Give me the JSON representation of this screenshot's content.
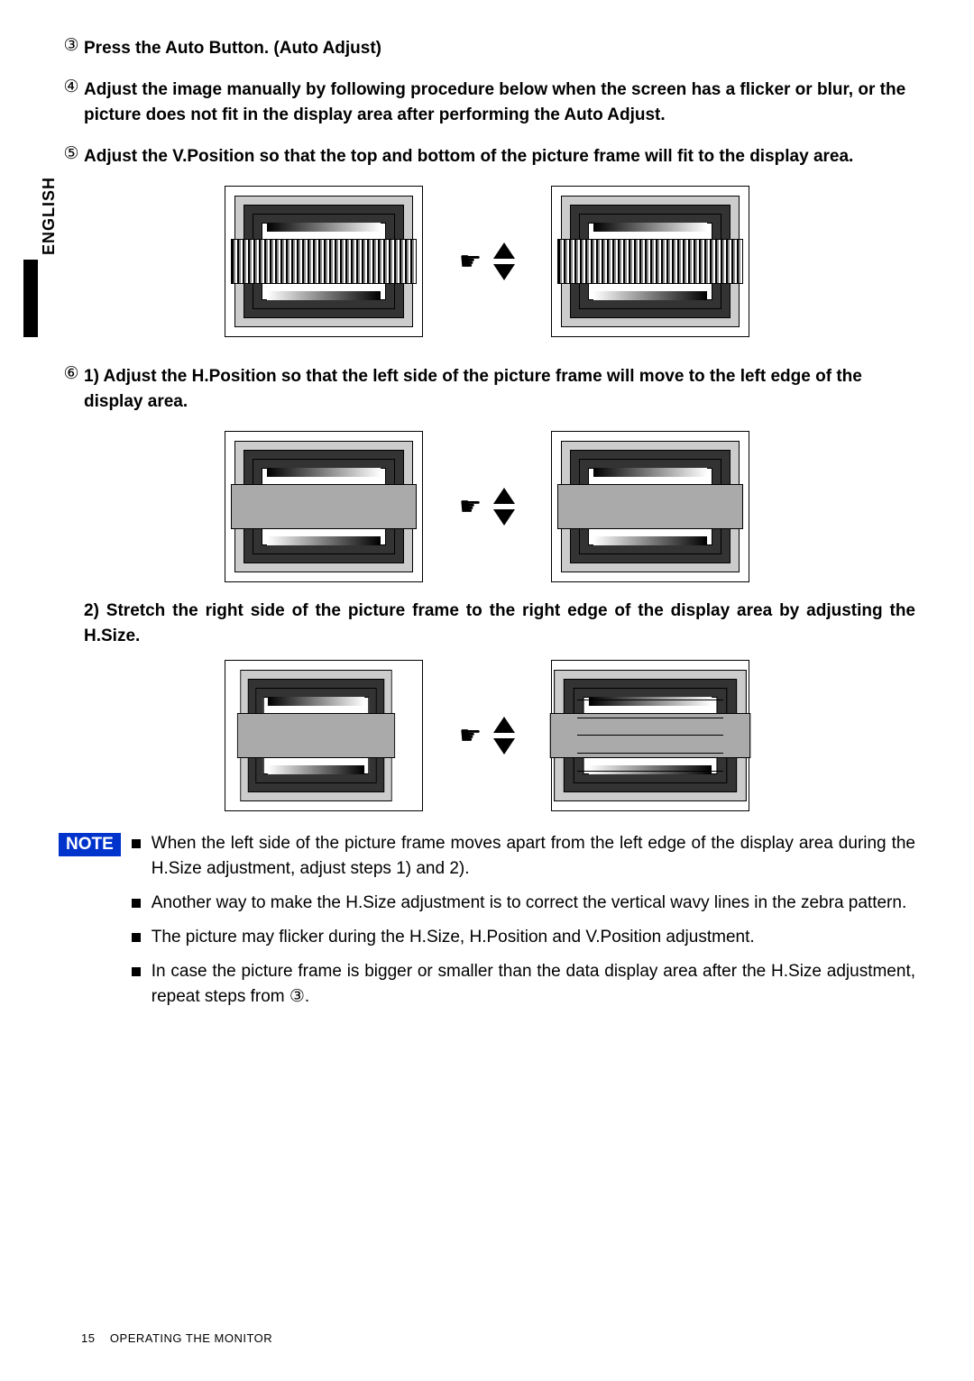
{
  "language_tab": "ENGLISH",
  "steps": {
    "s3": {
      "num": "③",
      "text": "Press the Auto Button. (Auto Adjust)"
    },
    "s4": {
      "num": "④",
      "text": "Adjust the image manually by following procedure below when the screen has a flicker or blur, or the picture does not fit in the display area after performing the Auto Adjust."
    },
    "s5": {
      "num": "⑤",
      "text": "Adjust the V.Position so that the top and bottom of the picture frame will fit to the display area."
    },
    "s6": {
      "num": "⑥",
      "text": "1) Adjust the H.Position so that the left side of the picture frame will move to the left edge of the display area."
    },
    "s6b": "2) Stretch the right side of the picture frame to the right edge of the display area by adjusting the H.Size."
  },
  "note": {
    "label": "NOTE",
    "items": [
      "When the left side of the picture frame moves apart from the left edge of the display area during the H.Size adjustment, adjust steps 1) and 2).",
      "Another way to make the H.Size adjustment is to correct the vertical wavy lines in the zebra pattern.",
      "The picture may flicker during the H.Size, H.Position and V.Position adjustment.",
      "In case the picture frame is bigger or smaller than the data display area after the H.Size adjustment, repeat steps from ③."
    ]
  },
  "footer": {
    "page": "15",
    "section": "OPERATING THE MONITOR"
  }
}
